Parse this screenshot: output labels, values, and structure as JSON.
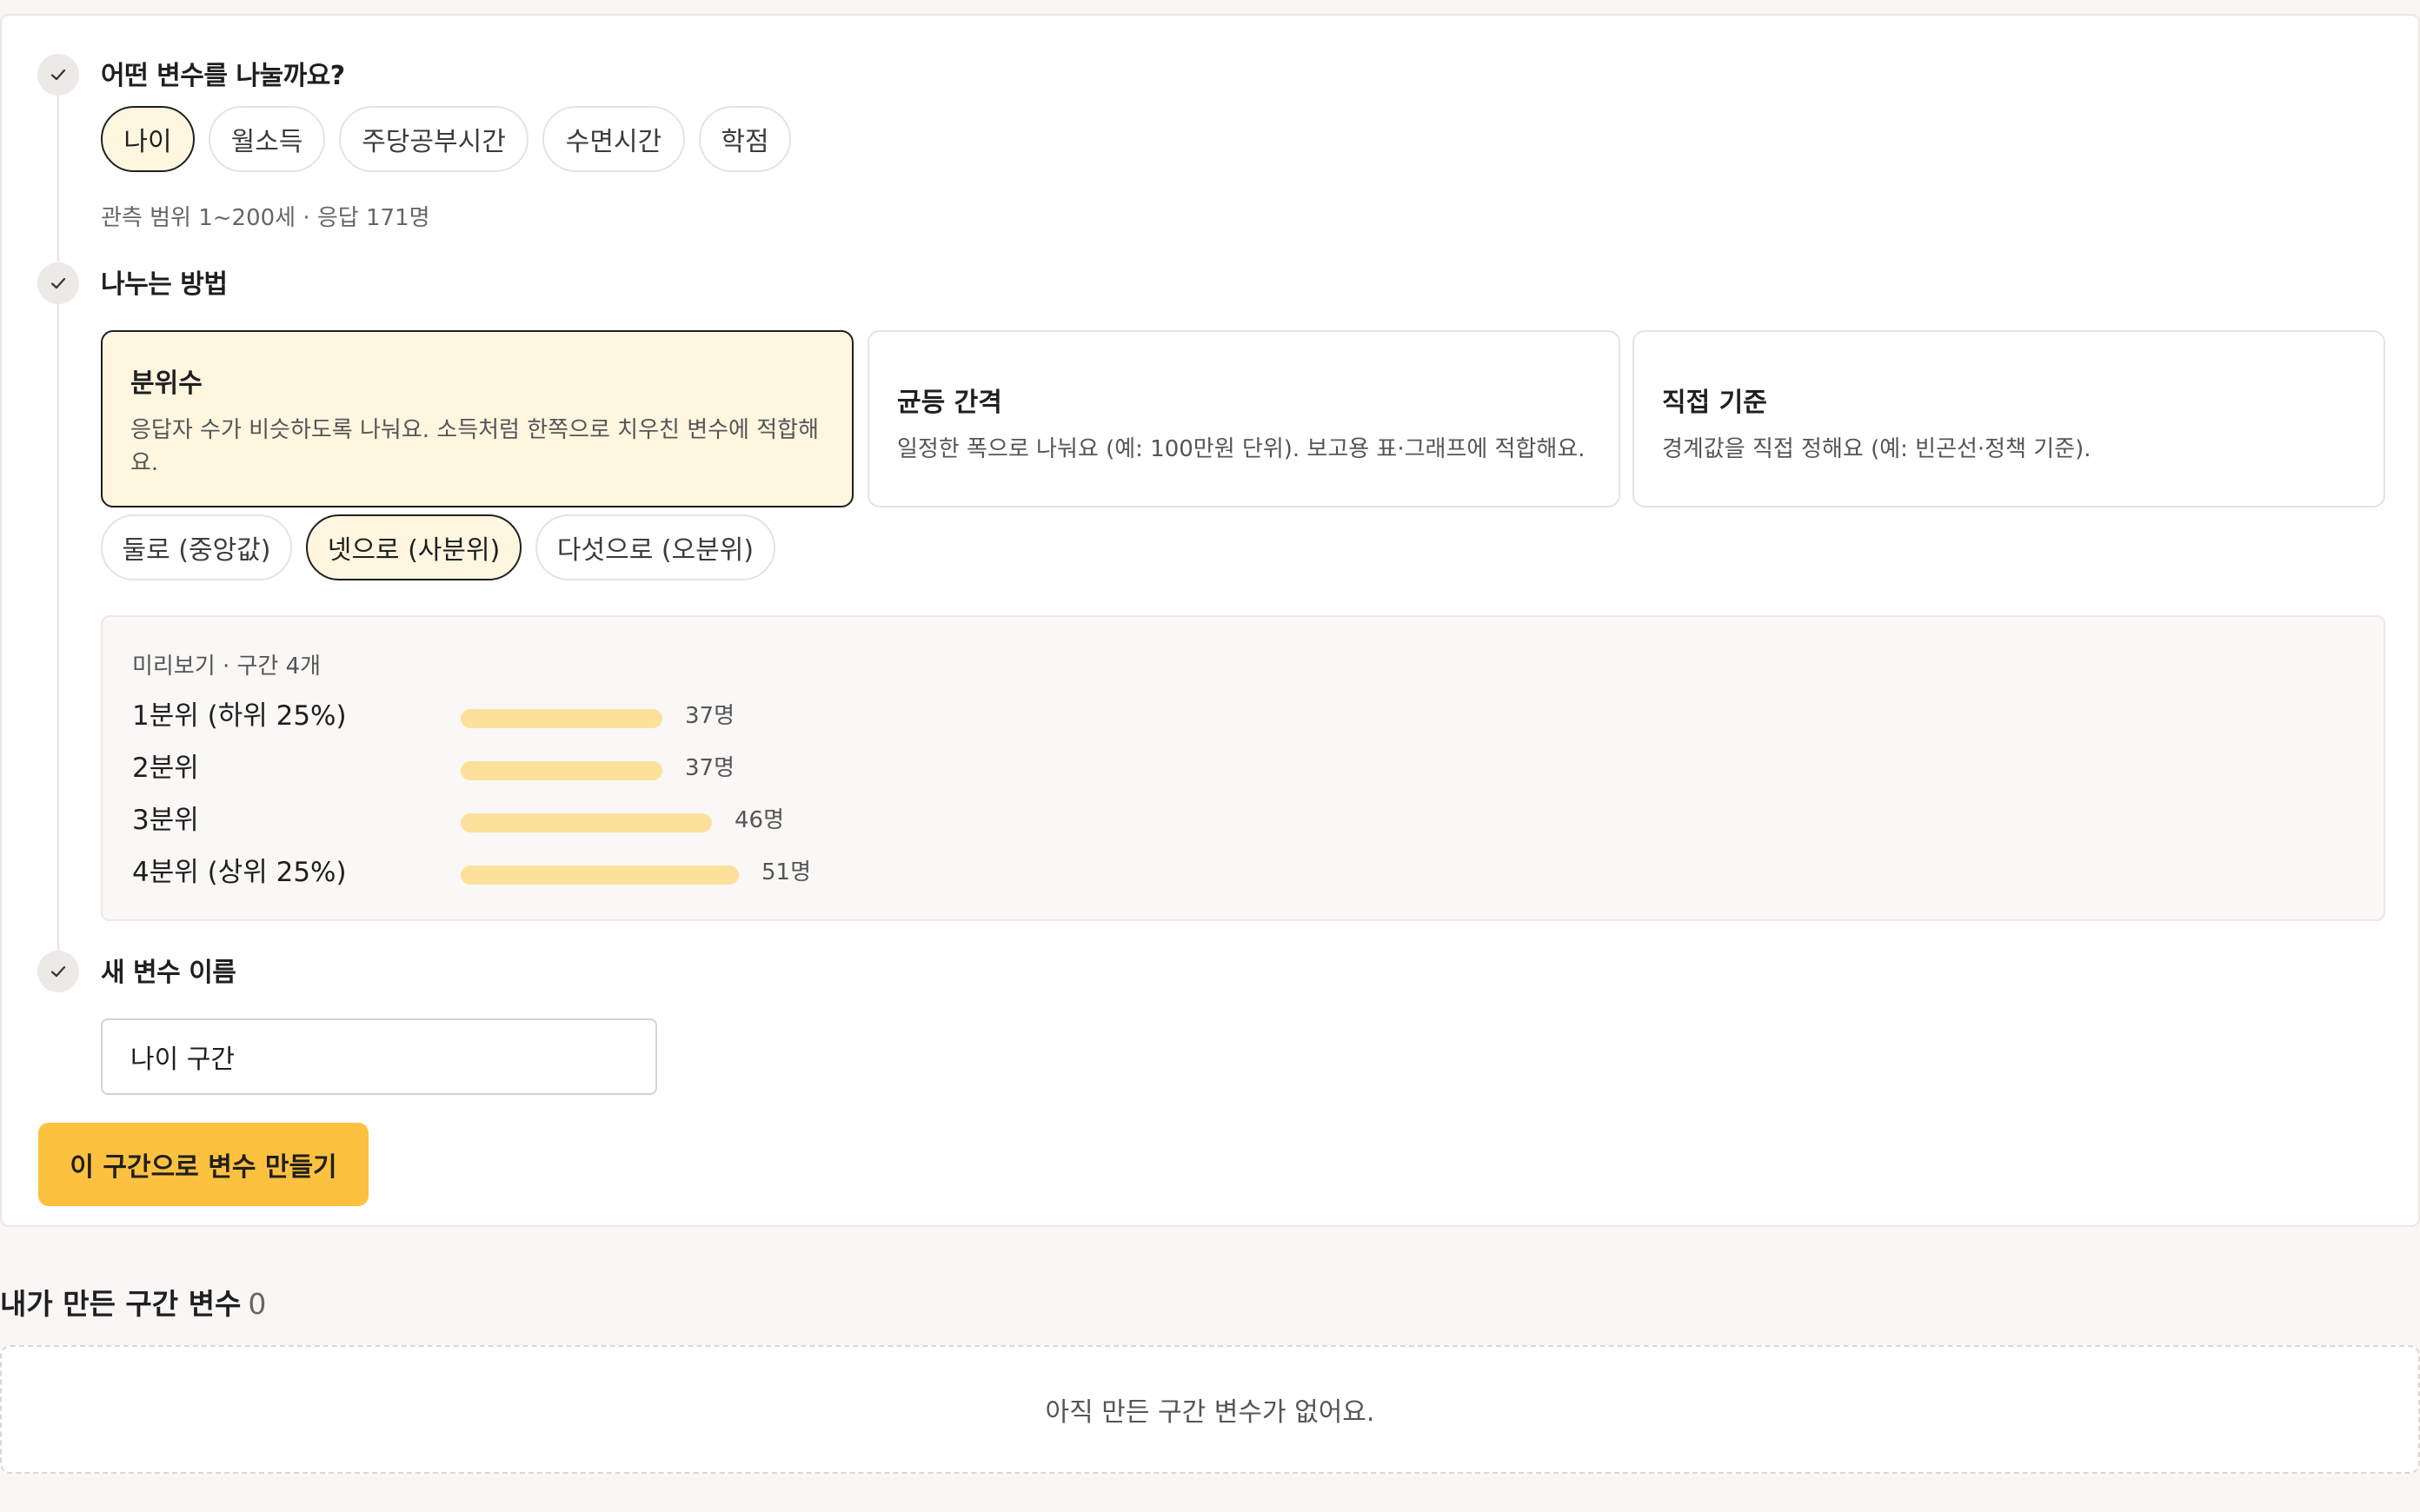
{
  "step1": {
    "title": "어떤 변수를 나눌까요?",
    "options": [
      "나이",
      "월소득",
      "주당공부시간",
      "수면시간",
      "학점"
    ],
    "selected": "나이",
    "hint": "관측 범위 1~200세 · 응답 171명"
  },
  "step2": {
    "title": "나누는 방법",
    "methods": [
      {
        "title": "분위수",
        "desc": "응답자 수가 비슷하도록 나눠요. 소득처럼 한쪽으로 치우친 변수에 적합해요."
      },
      {
        "title": "균등 간격",
        "desc": "일정한 폭으로 나눠요 (예: 100만원 단위). 보고용 표·그래프에 적합해요."
      },
      {
        "title": "직접 기준",
        "desc": "경계값을 직접 정해요 (예: 빈곤선·정책 기준)."
      }
    ],
    "selected_method": "분위수",
    "splits": [
      "둘로 (중앙값)",
      "넷으로 (사분위)",
      "다섯으로 (오분위)"
    ],
    "selected_split": "넷으로 (사분위)",
    "preview": {
      "title": "미리보기 · 구간 4개",
      "rows": [
        {
          "label": "1분위 (하위 25%)",
          "count": 37,
          "count_label": "37명"
        },
        {
          "label": "2분위",
          "count": 37,
          "count_label": "37명"
        },
        {
          "label": "3분위",
          "count": 46,
          "count_label": "46명"
        },
        {
          "label": "4분위 (상위 25%)",
          "count": 51,
          "count_label": "51명"
        }
      ]
    }
  },
  "step3": {
    "title": "새 변수 이름",
    "value": "나이 구간"
  },
  "create_button": "이 구간으로 변수 만들기",
  "my_vars": {
    "title": "내가 만든 구간 변수",
    "count": "0",
    "empty": "아직 만든 구간 변수가 없어요."
  },
  "colors": {
    "accent": "#fdc140",
    "selected_bg": "#fff6e0",
    "bar": "#fde19b"
  }
}
